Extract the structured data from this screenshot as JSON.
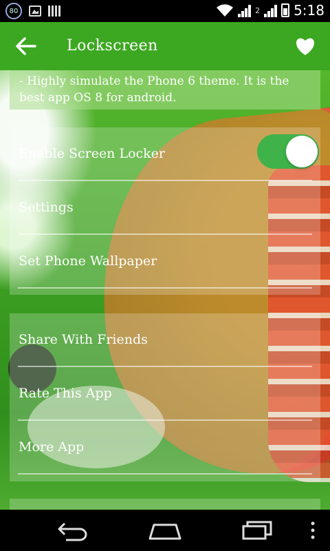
{
  "status_bar": {
    "notification_badge": "80",
    "sim_label": "2",
    "time": "5:18"
  },
  "app_bar": {
    "title": "Lockscreen",
    "back_icon": "arrow-left-icon",
    "favorite_icon": "heart-icon"
  },
  "description": {
    "text": " - Highly simulate the Phone 6 theme. It is the best app OS 8 for android."
  },
  "settings_section": {
    "items": [
      {
        "label": "Enable Screen Locker",
        "toggle_on": true
      },
      {
        "label": "Settings"
      },
      {
        "label": "Set Phone Wallpaper"
      }
    ]
  },
  "actions_section": {
    "items": [
      {
        "label": "Share With Friends"
      },
      {
        "label": "Rate This App"
      },
      {
        "label": "More App"
      }
    ]
  },
  "colors": {
    "app_bar": "#3ca821",
    "toggle_on": "#3fb34a"
  },
  "nav_bar": {
    "back_icon": "nav-back-icon",
    "home_icon": "nav-home-icon",
    "recents_icon": "nav-recents-icon",
    "menu_icon": "overflow-menu-icon"
  }
}
